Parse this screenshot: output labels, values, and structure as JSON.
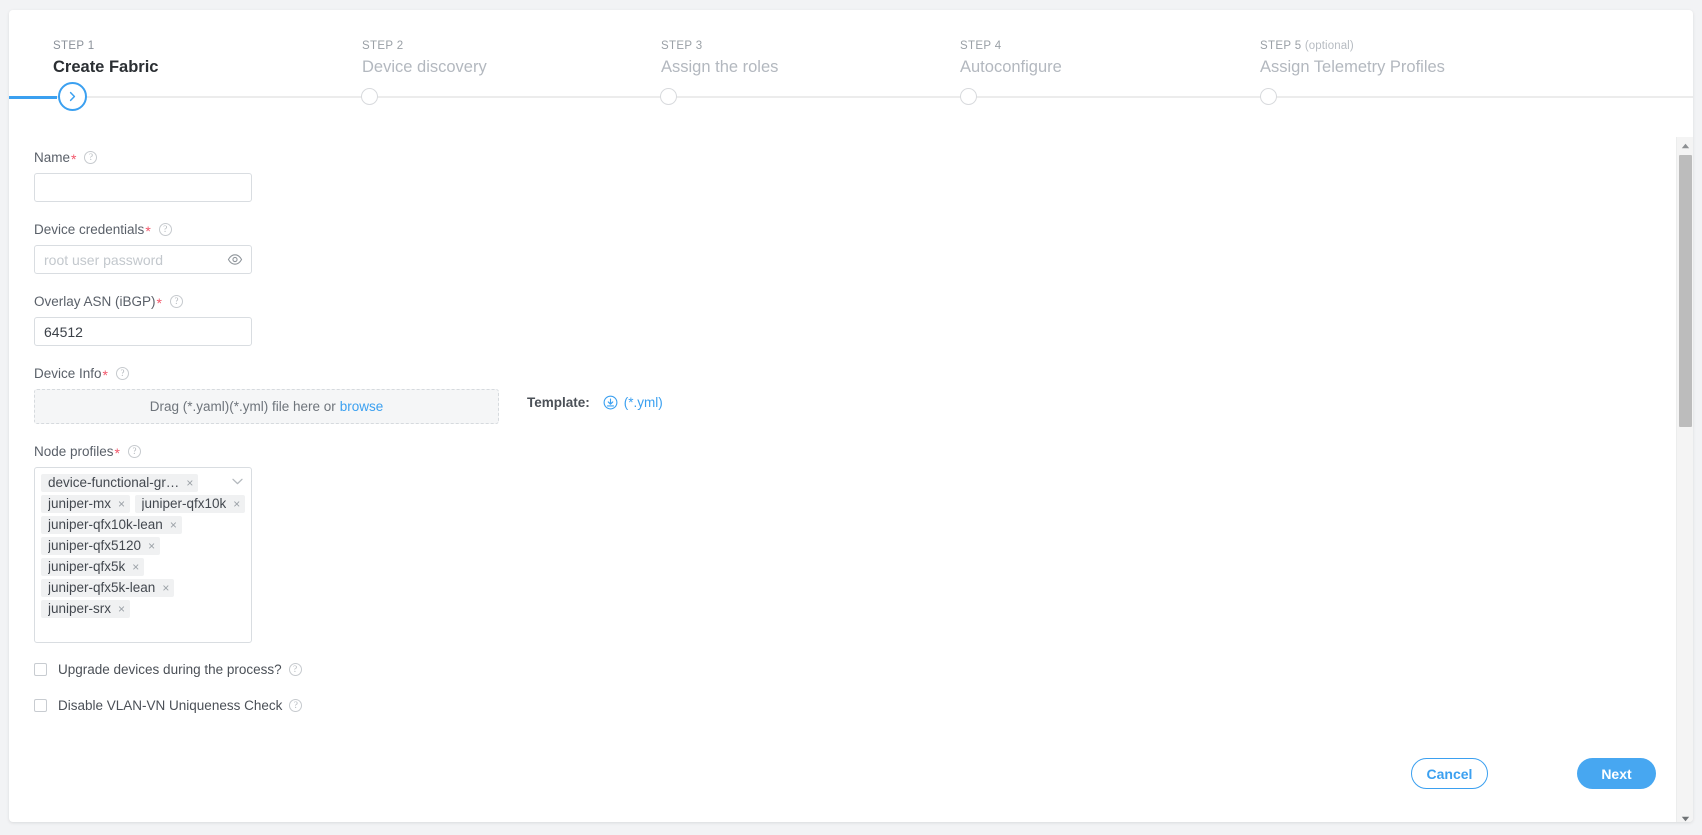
{
  "stepper": {
    "steps": [
      {
        "kicker": "STEP 1",
        "optional": "",
        "title": "Create Fabric",
        "active": true
      },
      {
        "kicker": "STEP 2",
        "optional": "",
        "title": "Device discovery",
        "active": false
      },
      {
        "kicker": "STEP 3",
        "optional": "",
        "title": "Assign the roles",
        "active": false
      },
      {
        "kicker": "STEP 4",
        "optional": "",
        "title": "Autoconfigure",
        "active": false
      },
      {
        "kicker": "STEP 5",
        "optional": " (optional)",
        "title": "Assign Telemetry Profiles",
        "active": false
      }
    ]
  },
  "form": {
    "name": {
      "label": "Name",
      "required": "*",
      "value": "",
      "placeholder": ""
    },
    "device_credentials": {
      "label": "Device credentials",
      "required": "*",
      "value": "",
      "placeholder": "root user password"
    },
    "overlay_asn": {
      "label": "Overlay ASN (iBGP)",
      "required": "*",
      "value": "64512",
      "placeholder": ""
    },
    "device_info": {
      "label": "Device Info",
      "required": "*",
      "dropzone_text": "Drag (*.yaml)(*.yml) file here or",
      "browse_label": "browse",
      "template_label": "Template:",
      "template_link": "(*.yml)"
    },
    "node_profiles": {
      "label": "Node profiles",
      "required": "*",
      "tags": [
        "device-functional-gr…",
        "juniper-mx",
        "juniper-qfx10k",
        "juniper-qfx10k-lean",
        "juniper-qfx5120",
        "juniper-qfx5k",
        "juniper-qfx5k-lean",
        "juniper-srx"
      ],
      "remove_glyph": "×"
    },
    "checkboxes": [
      {
        "label": "Upgrade devices during the process?",
        "checked": false,
        "help": true
      },
      {
        "label": "Disable VLAN-VN Uniqueness Check",
        "checked": false,
        "help": true
      }
    ],
    "help_glyph": "?"
  },
  "footer": {
    "cancel_label": "Cancel",
    "next_label": "Next"
  },
  "colors": {
    "accent": "#3ba0f0",
    "next_button": "#47a7f1",
    "required": "#f2566a",
    "page_bg": "#f2f3f5"
  }
}
